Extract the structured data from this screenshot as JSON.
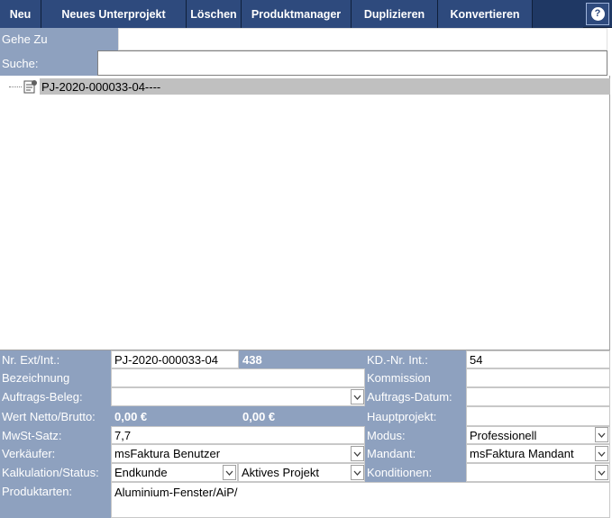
{
  "toolbar": {
    "buttons": [
      {
        "label": "Neu"
      },
      {
        "label": "Neues Unterprojekt"
      },
      {
        "label": "Löschen"
      },
      {
        "label": "Produktmanager"
      },
      {
        "label": "Duplizieren"
      },
      {
        "label": "Konvertieren"
      }
    ],
    "help_icon": "help-icon",
    "help_glyph": "?"
  },
  "goto": {
    "label": "Gehe Zu",
    "value": ""
  },
  "search": {
    "label": "Suche:",
    "value": ""
  },
  "tree": {
    "items": [
      {
        "label": "PJ-2020-000033-04----",
        "icon": "project-document-icon"
      }
    ]
  },
  "form": {
    "nr_ext_int": {
      "label": "Nr. Ext/Int.:",
      "ext": "PJ-2020-000033-04",
      "int": "438"
    },
    "kd_nr_int": {
      "label": "KD.-Nr. Int.:",
      "value": "54"
    },
    "bezeichnung": {
      "label": "Bezeichnung",
      "value": ""
    },
    "kommission": {
      "label": "Kommission",
      "value": ""
    },
    "auftrags_beleg": {
      "label": "Auftrags-Beleg:",
      "value": ""
    },
    "auftrags_datum": {
      "label": "Auftrags-Datum:",
      "value": ""
    },
    "wert": {
      "label": "Wert Netto/Brutto:",
      "netto": "0,00 €",
      "brutto": "0,00 €"
    },
    "hauptprojekt": {
      "label": "Hauptprojekt:",
      "value": ""
    },
    "mwst": {
      "label": "MwSt-Satz:",
      "value": "7,7"
    },
    "modus": {
      "label": "Modus:",
      "value": "Professionell"
    },
    "verkaeufer": {
      "label": "Verkäufer:",
      "value": "msFaktura Benutzer"
    },
    "mandant": {
      "label": "Mandant:",
      "value": "msFaktura Mandant"
    },
    "kalkulation": {
      "label": "Kalkulation/Status:",
      "kalkulation": "Endkunde",
      "status": "Aktives Projekt"
    },
    "konditionen": {
      "label": "Konditionen:",
      "value": ""
    },
    "produktarten": {
      "label": "Produktarten:",
      "value": "Aluminium-Fenster/AiP/"
    }
  },
  "colors": {
    "toolbar_bg": "#1f3864",
    "button_bg": "#2e4a7d",
    "label_bg": "#8ea1bf",
    "tree_selection": "#c0c0c0"
  }
}
